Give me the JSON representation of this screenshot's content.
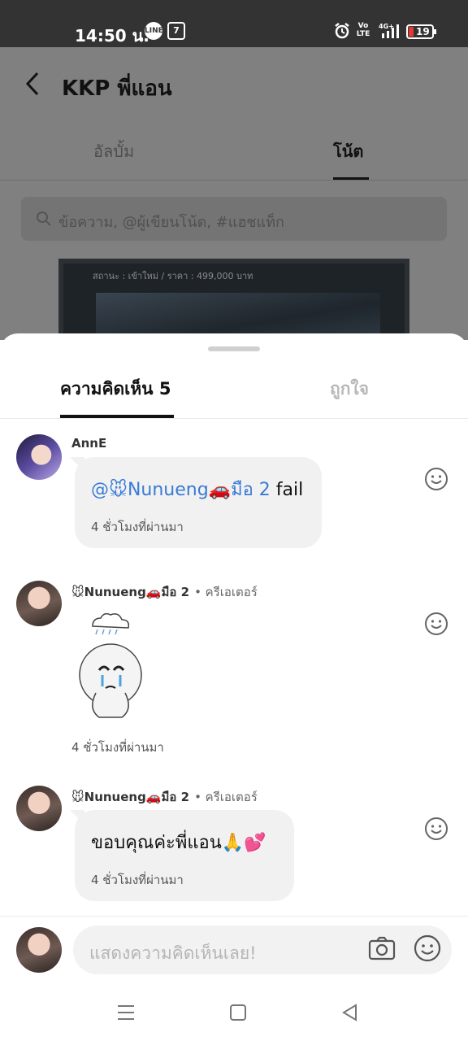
{
  "status_bar": {
    "time": "14:50 น.",
    "line_icon": "LINE",
    "seven_icon": "7",
    "volte": "Vo LTE",
    "network": "4G+",
    "battery": "19"
  },
  "background": {
    "title": "KKP พี่แอน",
    "tabs": [
      "อัลบั้ม",
      "โน้ต"
    ],
    "search_placeholder": "ข้อความ, @ผู้เขียนโน้ต, #แฮชแท็ก",
    "card_status": "สถานะ : เข้าใหม่ / ราคา : 499,000 บาท"
  },
  "sheet": {
    "tab_comments": "ความคิดเห็น 5",
    "tab_likes": "ถูกใจ"
  },
  "comments": [
    {
      "author": "AnnE",
      "mention": "@🐭Nunueng🚗มือ 2",
      "text": " fail",
      "time": "4 ชั่วโมงที่ผ่านมา"
    },
    {
      "author": "🐭Nunueng🚗มือ 2",
      "role": "• ครีเอเตอร์",
      "sticker": "crying-cloud-sticker",
      "time": "4 ชั่วโมงที่ผ่านมา"
    },
    {
      "author": "🐭Nunueng🚗มือ 2",
      "role": "• ครีเอเตอร์",
      "text": "ขอบคุณค่ะพี่แอน🙏💕",
      "time": "4 ชั่วโมงที่ผ่านมา"
    }
  ],
  "input": {
    "placeholder": "แสดงความคิดเห็นเลย!"
  },
  "icons": {
    "back": "back-arrow-icon",
    "search": "search-icon",
    "react": "smiley-icon",
    "camera": "camera-icon",
    "emoji": "emoji-icon",
    "nav_menu": "menu-icon",
    "nav_home": "home-icon",
    "nav_back": "back-triangle-icon"
  },
  "colors": {
    "mention": "#3a7bd5",
    "overlay": "#808080"
  }
}
